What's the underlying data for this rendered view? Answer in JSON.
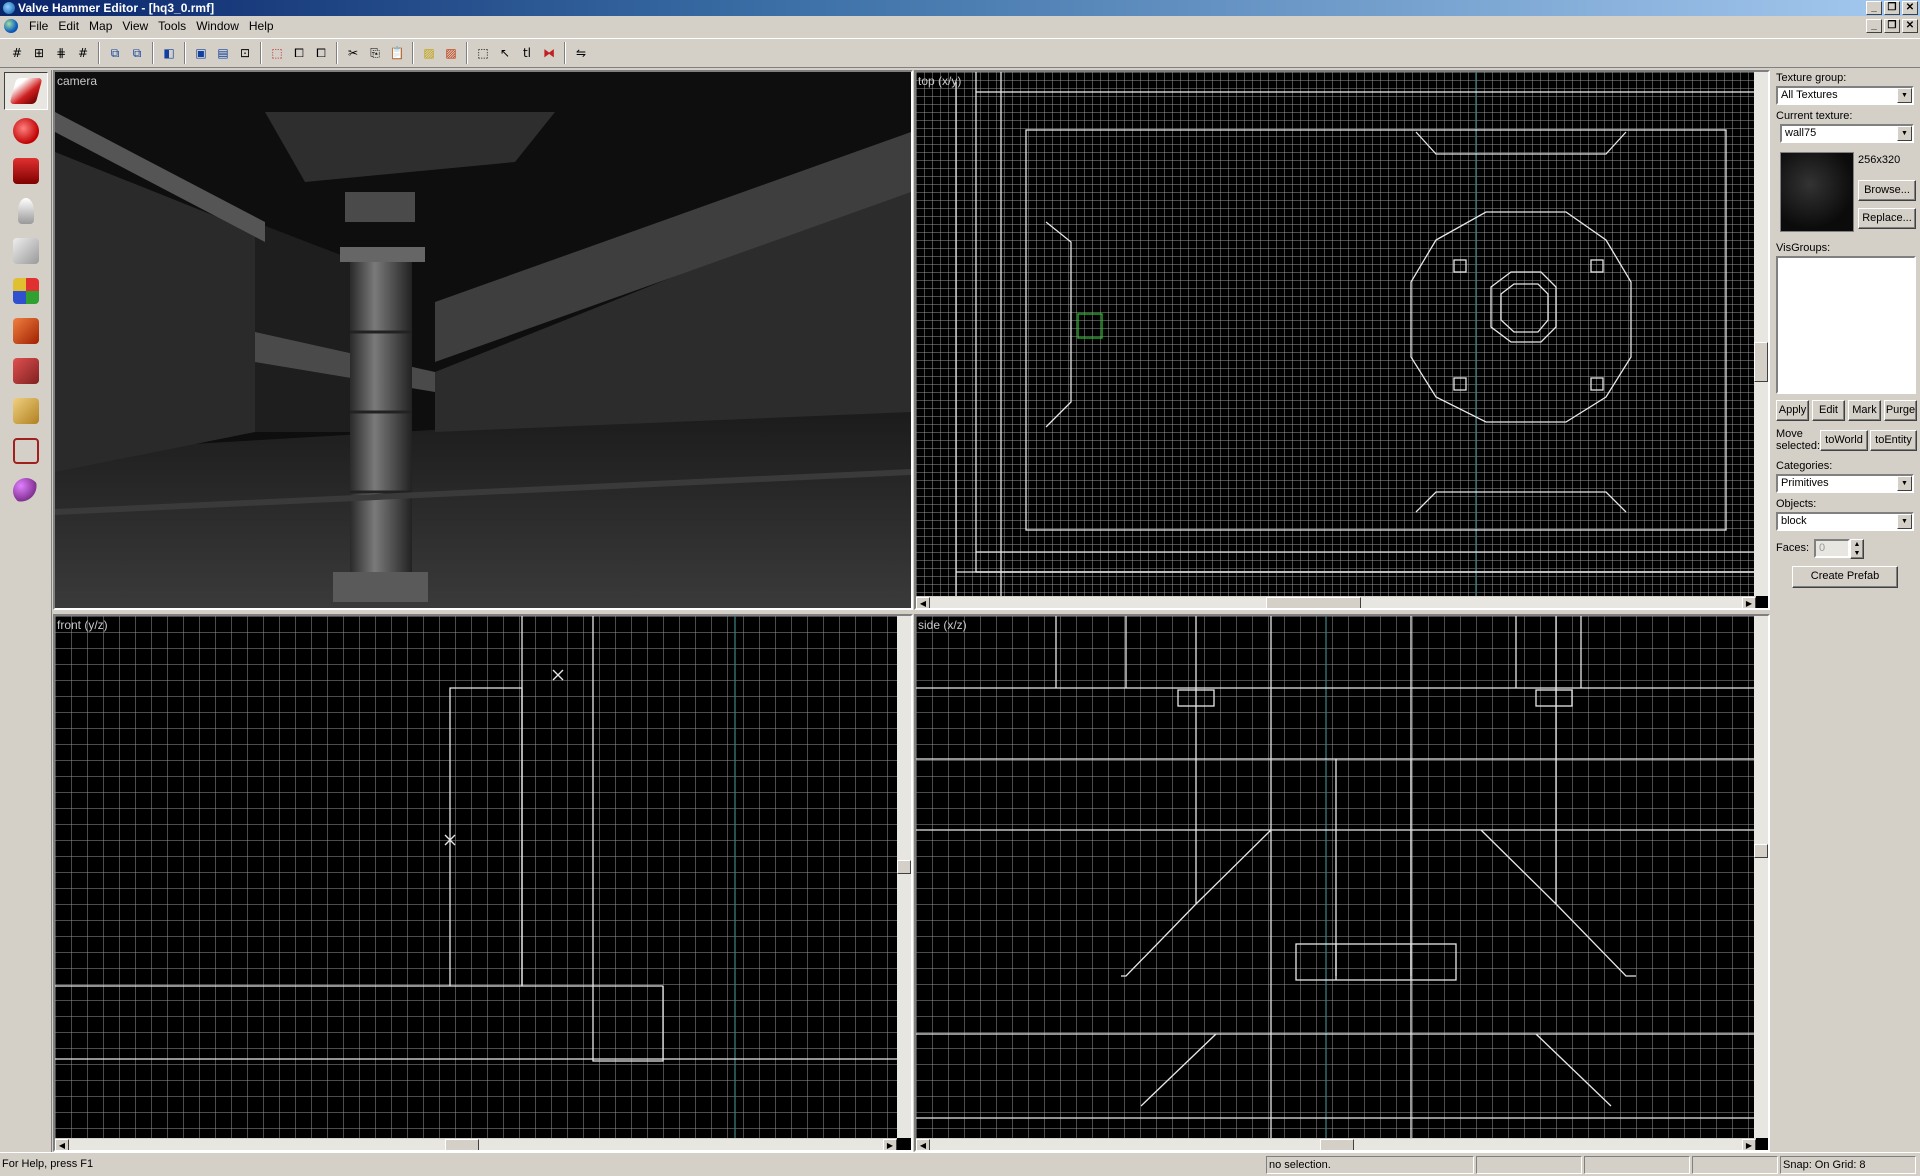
{
  "window": {
    "title": "Valve Hammer Editor - [hq3_0.rmf]"
  },
  "menu": {
    "items": [
      "File",
      "Edit",
      "Map",
      "View",
      "Tools",
      "Window",
      "Help"
    ]
  },
  "toolbar": {
    "buttons": [
      "grid-icon",
      "3d-grid-icon",
      "grid-small-icon",
      "grid-large-icon",
      "group-icon",
      "ungroup-icon",
      "carve-icon",
      "hide-icon",
      "show-icon",
      "cordon-icon",
      "red-box-icon",
      "copy-box-icon",
      "paste-box-icon",
      "cut-icon",
      "copy-icon",
      "paste-icon",
      "hazard-icon",
      "hazard2-icon",
      "select-icon",
      "cursor-icon",
      "texture-lock-icon",
      "flip-icon",
      "map-icon"
    ]
  },
  "tools": [
    "pointer",
    "magnify",
    "camera",
    "entity",
    "block",
    "texture",
    "apply-texture",
    "decal",
    "clip",
    "vertex",
    "path"
  ],
  "viewports": {
    "camera": {
      "label": "camera"
    },
    "top": {
      "label": "top (x/y)"
    },
    "front": {
      "label": "front (y/z)"
    },
    "side": {
      "label": "side (x/z)"
    }
  },
  "panel": {
    "texture_group_label": "Texture group:",
    "texture_group_value": "All Textures",
    "current_texture_label": "Current texture:",
    "current_texture_value": "wall75",
    "texture_size": "256x320",
    "browse_label": "Browse...",
    "replace_label": "Replace...",
    "visgroups_label": "VisGroups:",
    "apply_label": "Apply",
    "edit_label": "Edit",
    "mark_label": "Mark",
    "purge_label": "Purge",
    "move_selected_label": "Move selected:",
    "toworld_label": "toWorld",
    "toentity_label": "toEntity",
    "categories_label": "Categories:",
    "categories_value": "Primitives",
    "objects_label": "Objects:",
    "objects_value": "block",
    "faces_label": "Faces:",
    "faces_value": "0",
    "create_prefab_label": "Create Prefab"
  },
  "status": {
    "help": "For Help, press F1",
    "selection": "no selection.",
    "snap": "Snap: On Grid: 8"
  }
}
